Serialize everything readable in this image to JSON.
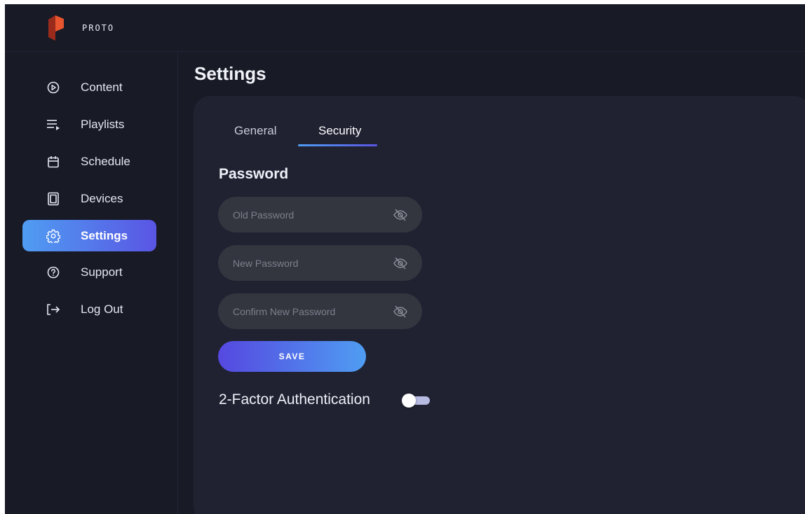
{
  "app": {
    "logo_text": "PROTO"
  },
  "sidebar": {
    "items": [
      {
        "label": "Content",
        "icon": "play-circle-icon"
      },
      {
        "label": "Playlists",
        "icon": "playlist-icon"
      },
      {
        "label": "Schedule",
        "icon": "calendar-icon"
      },
      {
        "label": "Devices",
        "icon": "devices-icon"
      },
      {
        "label": "Settings",
        "icon": "gear-icon",
        "active": true
      },
      {
        "label": "Support",
        "icon": "help-circle-icon"
      },
      {
        "label": "Log Out",
        "icon": "logout-icon"
      }
    ]
  },
  "main": {
    "title": "Settings",
    "tabs": [
      {
        "label": "General"
      },
      {
        "label": "Security",
        "active": true
      }
    ],
    "password": {
      "title": "Password",
      "fields": [
        {
          "placeholder": "Old Password",
          "value": ""
        },
        {
          "placeholder": "New Password",
          "value": ""
        },
        {
          "placeholder": "Confirm New Password",
          "value": ""
        }
      ],
      "save_label": "SAVE"
    },
    "two_factor": {
      "label": "2-Factor Authentication",
      "enabled": false
    }
  },
  "colors": {
    "background": "#181a26",
    "panel": "#202232",
    "field": "#33353f",
    "accent_blue": "#4f9df2",
    "accent_purple": "#5a55e4",
    "logo_red": "#c9402a"
  }
}
